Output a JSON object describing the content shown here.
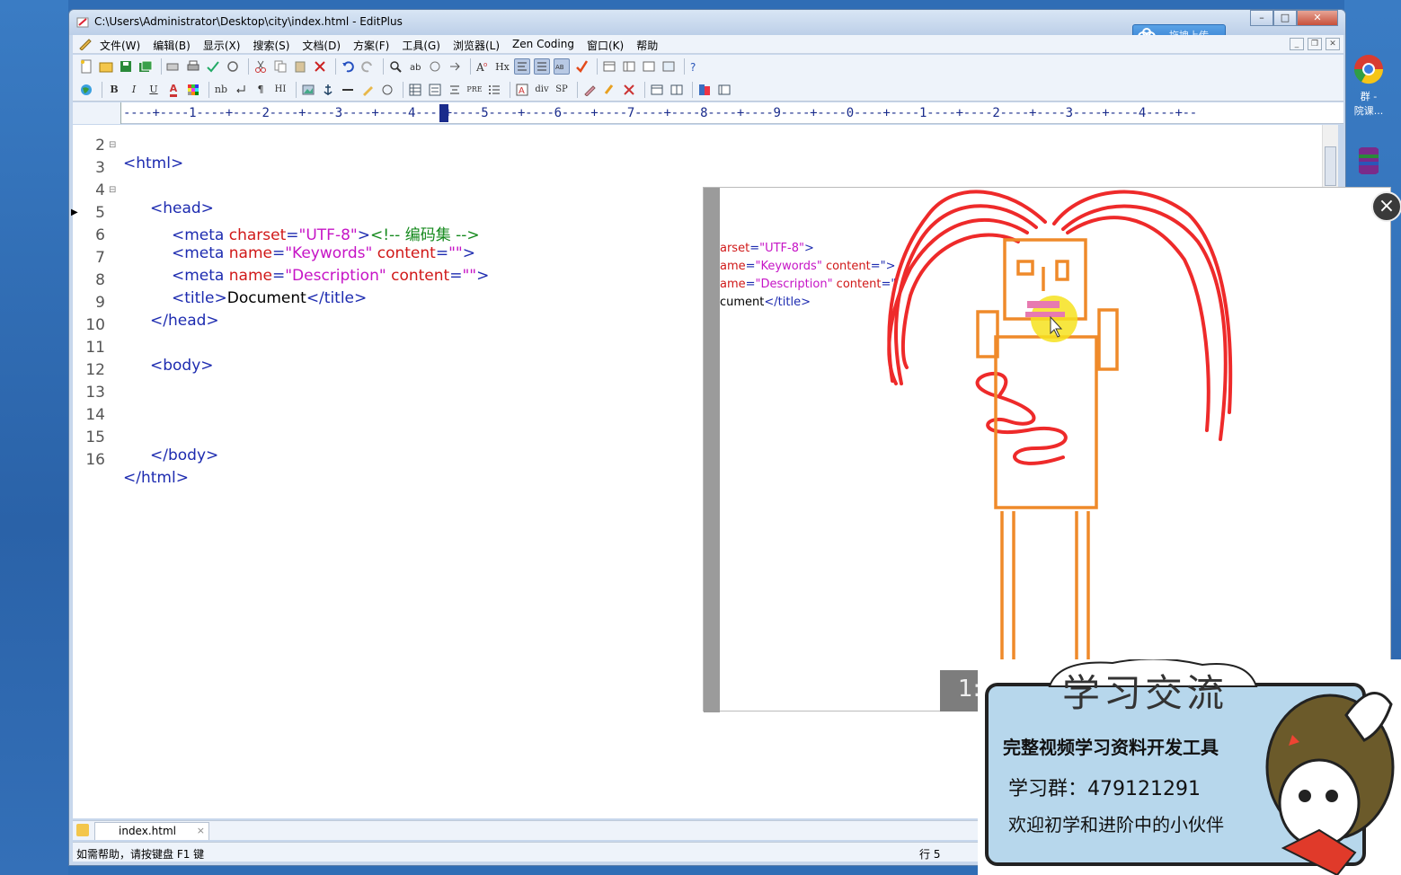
{
  "desktop": {
    "icons": [
      {
        "label": "群 -",
        "icon": "chrome-icon"
      },
      {
        "label": "院课...",
        "icon": "chrome-icon"
      }
    ]
  },
  "window": {
    "title": "C:\\Users\\Administrator\\Desktop\\city\\index.html - EditPlus",
    "controls": [
      "minimize",
      "maximize",
      "close"
    ]
  },
  "cloud_button": {
    "label": "拖拽上传"
  },
  "menu": [
    "文件(W)",
    "编辑(B)",
    "显示(X)",
    "搜索(S)",
    "文档(D)",
    "方案(F)",
    "工具(G)",
    "浏览器(L)",
    "Zen Coding",
    "窗口(K)",
    "帮助"
  ],
  "toolbar2_labels": {
    "bold": "B",
    "italic": "I",
    "underline": "U",
    "font": "A",
    "nb": "nb",
    "para": "¶",
    "hi": "HI",
    "pre": "PRE",
    "div": "div",
    "sp": "SP",
    "hx": "Hx"
  },
  "ruler": "----+----1----+----2----+----3----+----4----+----5----+----6----+----7----+----8----+----9----+----0----+----1----+----2----+----3----+----4----+--",
  "code_lines": [
    {
      "n": "2",
      "fold": true,
      "marker": false
    },
    {
      "n": "3",
      "fold": false,
      "marker": false
    },
    {
      "n": "4",
      "fold": true,
      "marker": false
    },
    {
      "n": "5",
      "fold": false,
      "marker": true
    },
    {
      "n": "6",
      "fold": false,
      "marker": false
    },
    {
      "n": "7",
      "fold": false,
      "marker": false
    },
    {
      "n": "8",
      "fold": false,
      "marker": false
    },
    {
      "n": "9",
      "fold": false,
      "marker": false
    },
    {
      "n": "10",
      "fold": false,
      "marker": false
    },
    {
      "n": "11",
      "fold": false,
      "marker": false
    },
    {
      "n": "12",
      "fold": false,
      "marker": false
    },
    {
      "n": "13",
      "fold": false,
      "marker": false
    },
    {
      "n": "14",
      "fold": false,
      "marker": false
    },
    {
      "n": "15",
      "fold": false,
      "marker": false
    },
    {
      "n": "16",
      "fold": false,
      "marker": false
    }
  ],
  "code": {
    "l2": "<html>",
    "l4": "<head>",
    "l5_open": "<meta ",
    "l5_attr": "charset",
    "l5_eq": "=",
    "l5_val": "\"UTF-8\"",
    "l5_close": ">",
    "l5_cmt": "<!-- 编码集 -->",
    "l6_open": "<meta ",
    "l6_attr1": "name",
    "l6_eq1": "=",
    "l6_val1": "\"Keywords\"",
    "l6_sp": " ",
    "l6_attr2": "content",
    "l6_eq2": "=",
    "l6_val2": "\"\"",
    "l6_close": ">",
    "l7_open": "<meta ",
    "l7_attr1": "name",
    "l7_eq1": "=",
    "l7_val1": "\"Description\"",
    "l7_sp": " ",
    "l7_attr2": "content",
    "l7_eq2": "=",
    "l7_val2": "\"\"",
    "l7_close": ">",
    "l8_open": "<title>",
    "l8_text": "Document",
    "l8_close": "</title>",
    "l9": "</head>",
    "l11": "<body>",
    "l15": "</body>",
    "l16": "</html>"
  },
  "overlay": {
    "snip1_attr": "arset",
    "snip1_eq": "=",
    "snip1_val": "\"UTF-8\"",
    "snip1_close": ">",
    "snip2_attr": "ame",
    "snip2_eq": "=",
    "snip2_val": "\"Keywords\"",
    "snip2_attr2": " content",
    "snip2_eq2": "=\"",
    "snip2_close": ">",
    "snip3_attr": "ame",
    "snip3_eq": "=",
    "snip3_val": "\"Description\"",
    "snip3_attr2": " content",
    "snip3_eq2": "=\"",
    "snip4_text": "cument",
    "snip4_close": "</title>",
    "time": "1:",
    "close_glyph": "×"
  },
  "promo": {
    "title": "学习交流",
    "line1": "完整视频学习资料开发工具",
    "line2": "学习群：479121291",
    "line3": "欢迎初学和进阶中的小伙伴"
  },
  "tab": {
    "label": "index.html",
    "close": "×"
  },
  "status": {
    "help": "如需帮助，请按键盘 F1 键",
    "position": "行 5"
  },
  "colors": {
    "tag": "#1d2bb0",
    "attr": "#d01818",
    "string": "#c614c6",
    "comment": "#14891c"
  }
}
